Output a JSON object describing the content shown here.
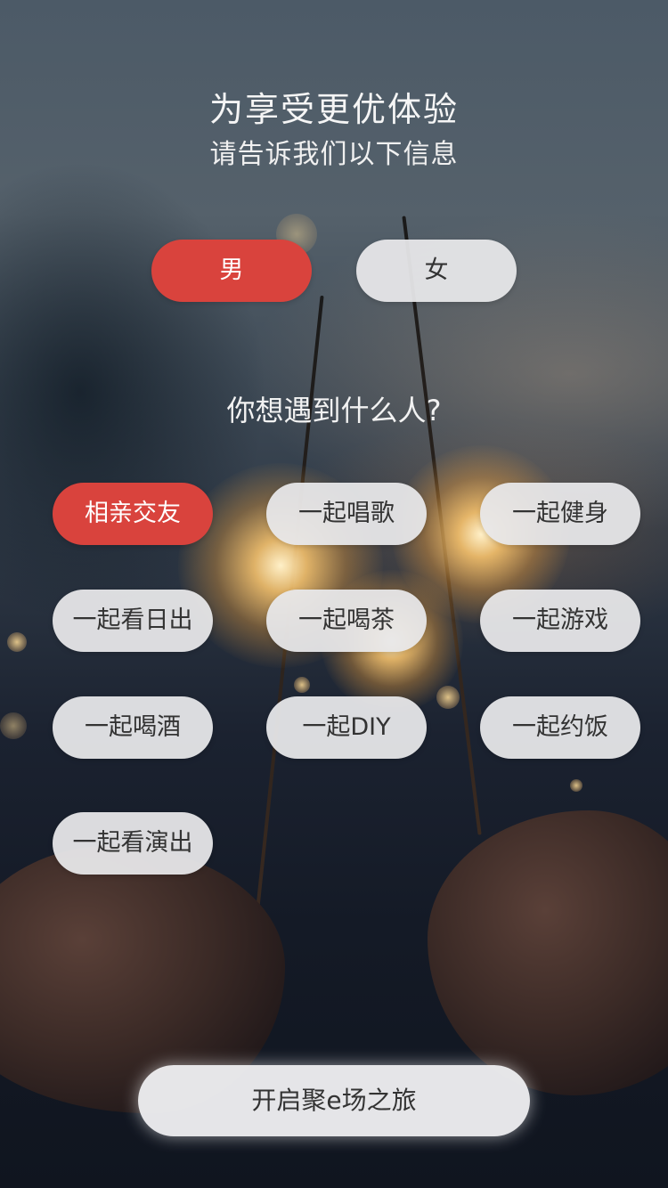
{
  "header": {
    "title": "为享受更优体验",
    "subtitle": "请告诉我们以下信息"
  },
  "gender": {
    "options": [
      {
        "label": "男",
        "selected": true
      },
      {
        "label": "女",
        "selected": false
      }
    ]
  },
  "question": "你想遇到什么人?",
  "interests": [
    {
      "label": "相亲交友",
      "selected": true
    },
    {
      "label": "一起唱歌",
      "selected": false
    },
    {
      "label": "一起健身",
      "selected": false
    },
    {
      "label": "一起看日出",
      "selected": false
    },
    {
      "label": "一起喝茶",
      "selected": false
    },
    {
      "label": "一起游戏",
      "selected": false
    },
    {
      "label": "一起喝酒",
      "selected": false
    },
    {
      "label": "一起DIY",
      "selected": false
    },
    {
      "label": "一起约饭",
      "selected": false
    },
    {
      "label": "一起看演出",
      "selected": false
    }
  ],
  "start_button": "开启聚e场之旅",
  "colors": {
    "accent": "#d9433d",
    "pill_bg": "#e8e8ea",
    "pill_text": "#333333"
  }
}
